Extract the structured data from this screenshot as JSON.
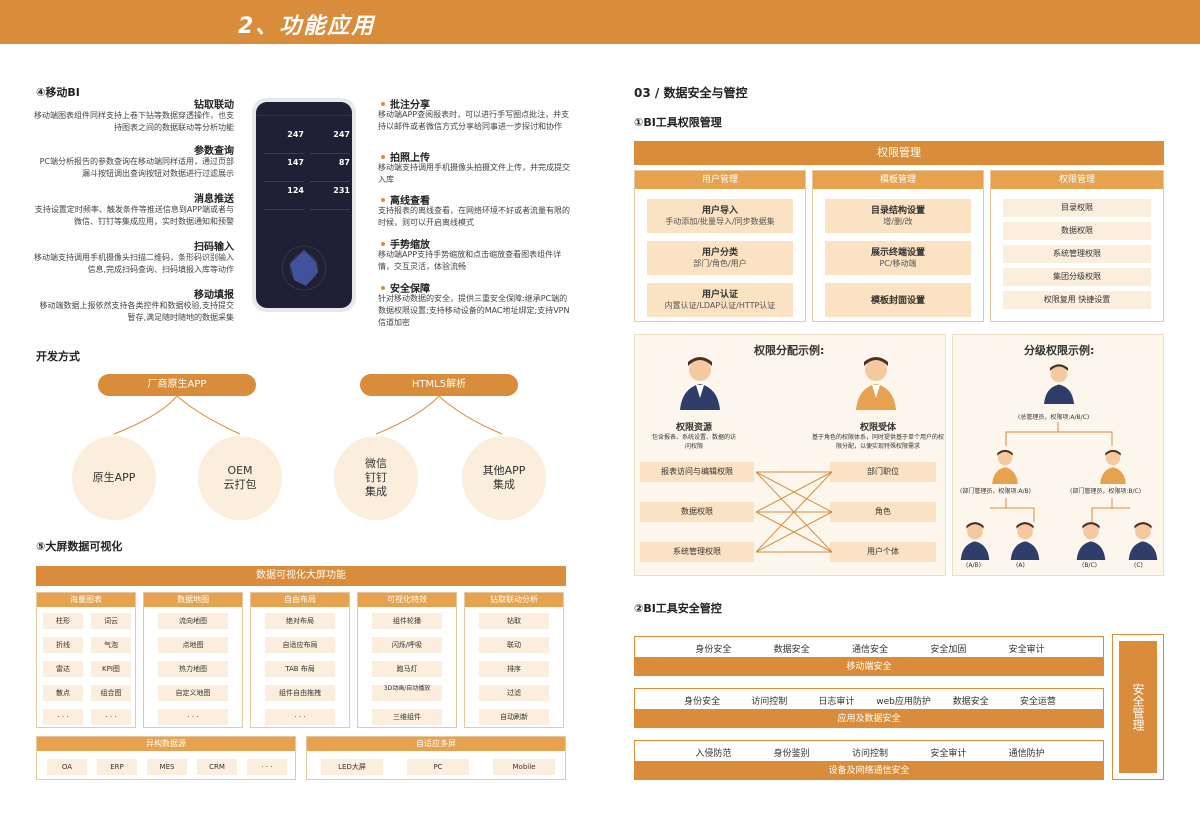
{
  "header": {
    "title": "2、功能应用"
  },
  "mobile": {
    "title": "④移动BI",
    "left": [
      {
        "h": "钻取联动",
        "t": "移动端图表组件同样支持上卷下钻等数据穿透操作，也支持图表之间的数据联动等分析功能"
      },
      {
        "h": "参数查询",
        "t": "PC端分析报告的参数查询在移动端同样适用，通过页部漏斗按钮调出查询按钮对数据进行过滤展示"
      },
      {
        "h": "消息推送",
        "t": "支持设置定时频率、触发条件等推送信息到APP端或者与微信、钉钉等集成应用，实时数据通知和预警"
      },
      {
        "h": "扫码输入",
        "t": "移动端支持调用手机摄像头扫描二维码，条形码识别输入信息,完成扫码查询、扫码填报入库等动作"
      },
      {
        "h": "移动填报",
        "t": "移动端数据上报依然支持各类控件和数据校验,支持提交暂存,满足随时随地的数据采集"
      }
    ],
    "right": [
      {
        "h": "批注分享",
        "t": "移动端APP查阅报表时，可以进行手写圈点批注，并支持以邮件或者微信方式分享给同事进一步探讨和协作"
      },
      {
        "h": "拍照上传",
        "t": "移动端支持调用手机摄像头拍摄文件上传，并完成提交入库"
      },
      {
        "h": "离线查看",
        "t": "支持报表的离线查看，在网络环境不好或者流量有限的时候，则可以开启离线模式"
      },
      {
        "h": "手势缩放",
        "t": "移动端APP支持手势缩放和点击缩放查看图表组件详情，交互灵活，体验流畅"
      },
      {
        "h": "安全保障",
        "t": "针对移动数据的安全，提供三重安全保障:继承PC端的数据权限设置;支持移动设备的MAC地址绑定;支持VPN信道加密"
      }
    ],
    "phone_values": [
      "247",
      "247",
      "147",
      "87",
      "124",
      "231"
    ]
  },
  "dev": {
    "title": "开发方式",
    "a": "厂商原生APP",
    "b": "HTML5解析",
    "c1": "原生APP",
    "c2": "OEM\n云打包",
    "c3": "微信\n钉钉\n集成",
    "c4": "其他APP\n集成"
  },
  "viz": {
    "title": "⑤大屏数据可视化",
    "bar": "数据可视化大屏功能",
    "cols": [
      {
        "h": "海量图表",
        "items": [
          "柱形",
          "词云",
          "折线",
          "气泡",
          "雷达",
          "KPI图",
          "散点",
          "组合图",
          "· · ·",
          "· · ·"
        ]
      },
      {
        "h": "数据地图",
        "items": [
          "流向地图",
          "点地图",
          "热力地图",
          "自定义地图",
          "· · ·"
        ]
      },
      {
        "h": "自由布局",
        "items": [
          "绝对布局",
          "自适应布局",
          "TAB 布局",
          "组件自由拖拽",
          "· · ·"
        ]
      },
      {
        "h": "可视化特效",
        "items": [
          "组件轮播",
          "闪烁/呼吸",
          "跑马灯",
          "3D动画/自动播放",
          "三维组件"
        ]
      },
      {
        "h": "钻取联动分析",
        "items": [
          "钻取",
          "联动",
          "排序",
          "过滤",
          "自动刷新"
        ]
      }
    ],
    "src": {
      "h": "异构数据源",
      "items": [
        "OA",
        "ERP",
        "MES",
        "CRM",
        "· · ·"
      ]
    },
    "screen": {
      "h": "自适应多屏",
      "items": [
        "LED大屏",
        "PC",
        "Mobile"
      ]
    }
  },
  "sec": {
    "title": "03 / 数据安全与管控",
    "sub1": "①BI工具权限管理",
    "perm_bar": "权限管理",
    "user": {
      "h": "用户管理",
      "items": [
        [
          "用户导入",
          "手动添加/批量导入/同步数据集"
        ],
        [
          "用户分类",
          "部门/角色/用户"
        ],
        [
          "用户认证",
          "内置认证/LDAP认证/HTTP认证"
        ]
      ]
    },
    "tmpl": {
      "h": "模板管理",
      "items": [
        [
          "目录结构设置",
          "增/删/改"
        ],
        [
          "展示终端设置",
          "PC/移动端"
        ],
        [
          "模板封面设置",
          ""
        ]
      ]
    },
    "auth": {
      "h": "权限管理",
      "items": [
        "目录权限",
        "数据权限",
        "系统管理权限",
        "集团分级权限",
        "权限复用 快捷设置"
      ]
    },
    "ex1": {
      "title": "权限分配示例:",
      "res": "权限资源",
      "res_d": "包含报表、系统设置、数据的访问权限",
      "tgt": "权限受体",
      "tgt_d": "基于角色的权限体系，同时提供基于单个用户的权限分配，以便实现特殊权限需求",
      "left": [
        "报表访问与编辑权限",
        "数据权限",
        "系统管理权限"
      ],
      "right": [
        "部门职位",
        "角色",
        "用户个体"
      ]
    },
    "ex2": {
      "title": "分级权限示例:",
      "top": "(总管理员，权限项:A/B/C)",
      "mid1": "(部门管理员，权限项:A/B)",
      "mid2": "(部门管理员，权限项:B/C)",
      "leaf": [
        "(A/B)",
        "(A)",
        "(B/C)",
        "(C)"
      ]
    },
    "sub2": "②BI工具安全管控",
    "rows": [
      {
        "items": [
          "身份安全",
          "数据安全",
          "通信安全",
          "安全加固",
          "安全审计"
        ],
        "bar": "移动端安全"
      },
      {
        "items": [
          "身份安全",
          "访问控制",
          "日志审计",
          "web应用防护",
          "数据安全",
          "安全运营"
        ],
        "bar": "应用及数据安全"
      },
      {
        "items": [
          "入侵防范",
          "身份鉴别",
          "访问控制",
          "安全审计",
          "通信防护"
        ],
        "bar": "设备及网络通信安全"
      }
    ],
    "side": "安全管理"
  },
  "colors": {
    "accent": "#d98c3a",
    "light": "#fbeedd"
  }
}
